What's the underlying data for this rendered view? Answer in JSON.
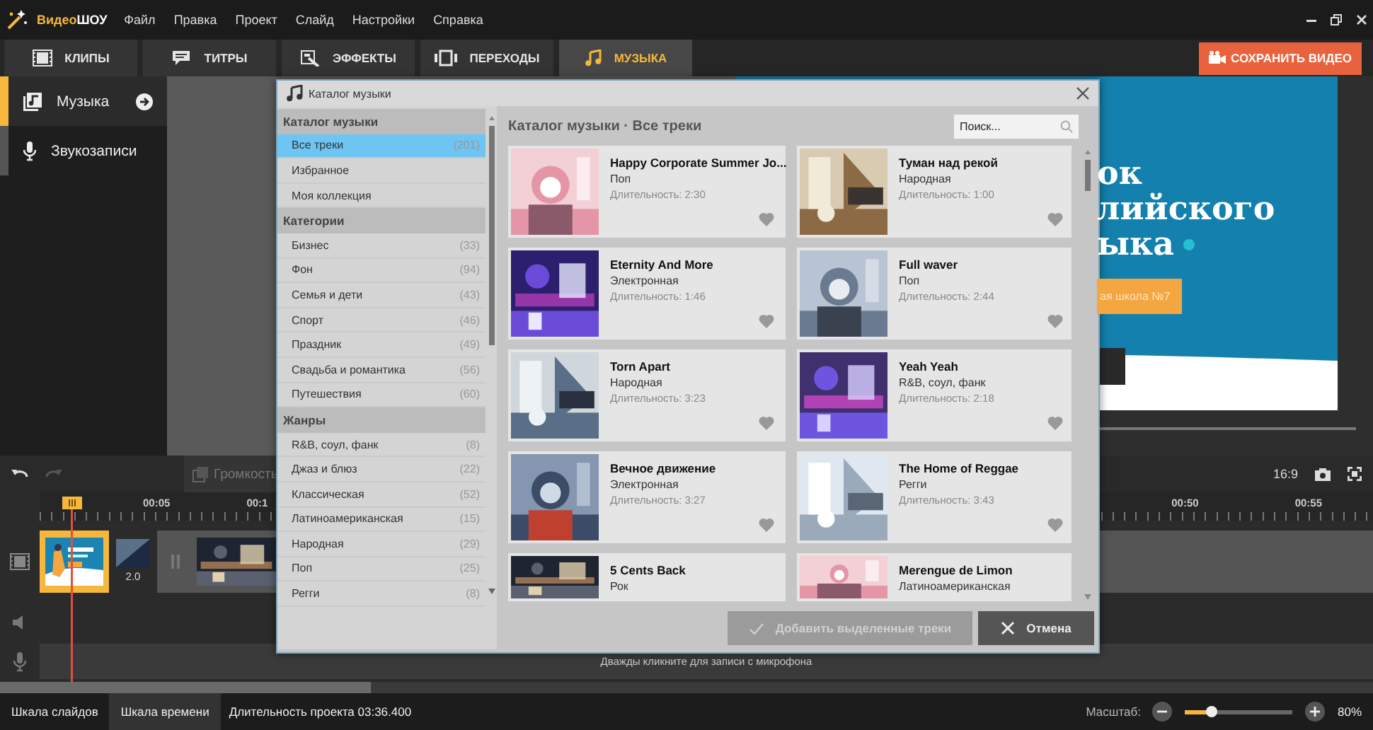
{
  "app": {
    "name_accent": "Видео",
    "name_rest": "ШОУ"
  },
  "menu": [
    "Файл",
    "Правка",
    "Проект",
    "Слайд",
    "Настройки",
    "Справка"
  ],
  "tabs": [
    {
      "label": "КЛИПЫ",
      "kind": "clips",
      "selected": false
    },
    {
      "label": "ТИТРЫ",
      "kind": "titles",
      "selected": false
    },
    {
      "label": "ЭФФЕКТЫ",
      "kind": "effects",
      "selected": false
    },
    {
      "label": "ПЕРЕХОДЫ",
      "kind": "transitions",
      "selected": false
    },
    {
      "label": "МУЗЫКА",
      "kind": "music",
      "selected": true
    }
  ],
  "save_button": "СОХРАНИТЬ ВИДЕО",
  "sidebar": {
    "items": [
      {
        "label": "Музыка",
        "kind": "music",
        "selected": true
      },
      {
        "label": "Звукозаписи",
        "kind": "mic",
        "selected": false
      }
    ]
  },
  "preview": {
    "slide_lines": [
      "ок",
      "лийского",
      "ыка"
    ],
    "slide_button": "ая школа №7"
  },
  "toolbar": {
    "volume_button": "Громкость",
    "aspect_ratio": "16:9"
  },
  "timeline": {
    "ruler_left": [
      "00:05",
      "00:1"
    ],
    "ruler_right": [
      "00:50",
      "00:55"
    ],
    "transition_duration": "2.0",
    "mic_hint": "Дважды кликните для записи с микрофона"
  },
  "status_bar": {
    "tabs": [
      {
        "label": "Шкала слайдов",
        "selected": false
      },
      {
        "label": "Шкала времени",
        "selected": true
      }
    ],
    "duration": "Длительность проекта 03:36.400",
    "zoom_label": "Масштаб:",
    "zoom": {
      "level": 0.25
    },
    "zoom_value": "80%"
  },
  "dialog": {
    "title": "Каталог музыки",
    "groups": [
      {
        "title": "Каталог музыки",
        "items": [
          {
            "label": "Все треки",
            "count": "(201)",
            "selected": true
          },
          {
            "label": "Избранное",
            "selected": false
          },
          {
            "label": "Моя коллекция",
            "selected": false
          }
        ]
      },
      {
        "title": "Категории",
        "items": [
          {
            "label": "Бизнес",
            "count": "(33)",
            "selected": false
          },
          {
            "label": "Фон",
            "count": "(94)",
            "selected": false
          },
          {
            "label": "Семья и дети",
            "count": "(43)",
            "selected": false
          },
          {
            "label": "Спорт",
            "count": "(46)",
            "selected": false
          },
          {
            "label": "Праздник",
            "count": "(49)",
            "selected": false
          },
          {
            "label": "Свадьба и романтика",
            "count": "(56)",
            "selected": false
          },
          {
            "label": "Путешествия",
            "count": "(60)",
            "selected": false
          }
        ]
      },
      {
        "title": "Жанры",
        "items": [
          {
            "label": "R&B, соул, фанк",
            "count": "(8)",
            "selected": false
          },
          {
            "label": "Джаз и блюз",
            "count": "(22)",
            "selected": false
          },
          {
            "label": "Классическая",
            "count": "(52)",
            "selected": false
          },
          {
            "label": "Латиноамериканская",
            "count": "(15)",
            "selected": false
          },
          {
            "label": "Народная",
            "count": "(29)",
            "selected": false
          },
          {
            "label": "Поп",
            "count": "(25)",
            "selected": false
          },
          {
            "label": "Регги",
            "count": "(8)",
            "selected": false
          }
        ]
      }
    ],
    "header": "Каталог музыки · Все треки",
    "search": {
      "placeholder": "Поиск..."
    },
    "tracks": [
      {
        "title": "Happy Corporate Summer Jo...",
        "genre": "Поп",
        "duration": "Длительность: 2:30"
      },
      {
        "title": "Туман над рекой",
        "genre": "Народная",
        "duration": "Длительность: 1:00"
      },
      {
        "title": "Eternity And More",
        "genre": "Электронная",
        "duration": "Длительность: 1:46"
      },
      {
        "title": "Full waver",
        "genre": "Поп",
        "duration": "Длительность: 2:44"
      },
      {
        "title": "Torn Apart",
        "genre": "Народная",
        "duration": "Длительность: 3:23"
      },
      {
        "title": "Yeah Yeah",
        "genre": "R&B, соул, фанк",
        "duration": "Длительность: 2:18"
      },
      {
        "title": "Вечное движение",
        "genre": "Электронная",
        "duration": "Длительность: 3:27"
      },
      {
        "title": "The Home of Reggae",
        "genre": "Регги",
        "duration": "Длительность: 3:43"
      },
      {
        "title": "5 Cents Back",
        "genre": "Рок"
      },
      {
        "title": "Merengue de Limon",
        "genre": "Латиноамериканская"
      }
    ],
    "buttons": [
      {
        "label": "Добавить выделенные треки",
        "kind": "add",
        "disabled": true
      },
      {
        "label": "Отмена",
        "kind": "cancel",
        "disabled": false
      }
    ]
  }
}
